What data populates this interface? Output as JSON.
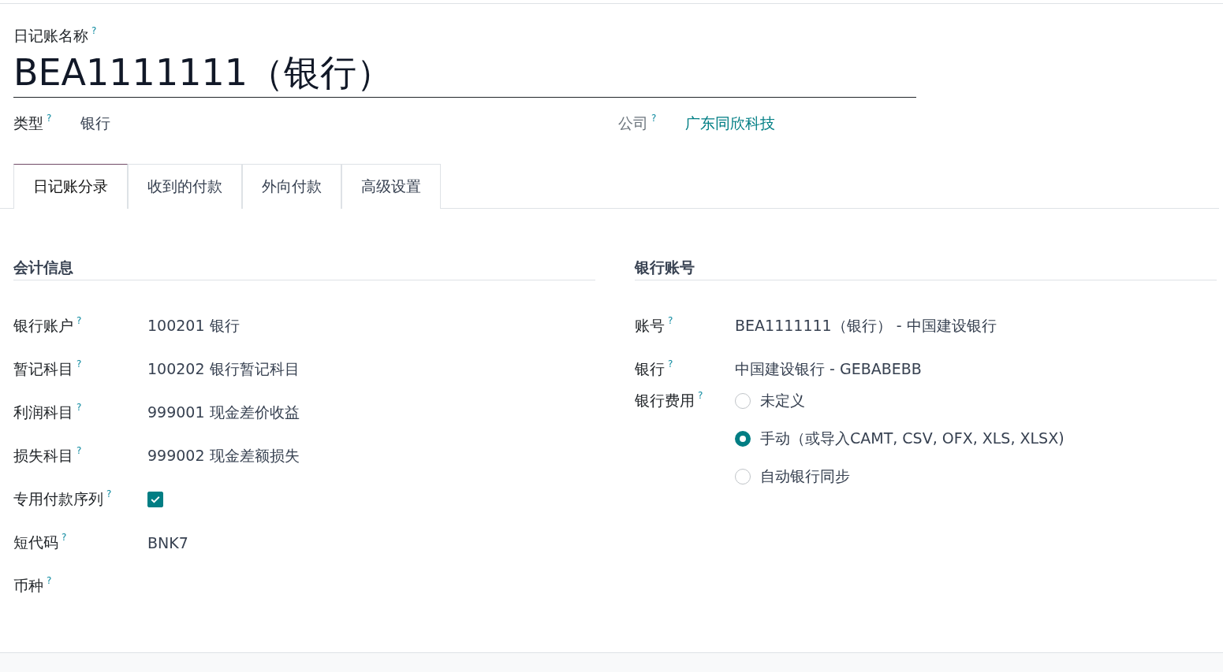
{
  "journal_name": {
    "label": "日记账名称",
    "help": "?",
    "value": "BEA1111111（银行）"
  },
  "type_field": {
    "label": "类型",
    "help": "?",
    "value": "银行"
  },
  "company_field": {
    "label": "公司",
    "help": "?",
    "value": "广东同欣科技"
  },
  "tabs": [
    {
      "label": "日记账分录",
      "selected": true
    },
    {
      "label": "收到的付款",
      "selected": false
    },
    {
      "label": "外向付款",
      "selected": false
    },
    {
      "label": "高级设置",
      "selected": false
    }
  ],
  "accounting": {
    "title": "会计信息",
    "fields": [
      {
        "kind": "text",
        "label": "银行账户",
        "help": "?",
        "value": "100201 银行"
      },
      {
        "kind": "text",
        "label": "暂记科目",
        "help": "?",
        "value": "100202 银行暂记科目"
      },
      {
        "kind": "text",
        "label": "利润科目",
        "help": "?",
        "value": "999001 现金差价收益"
      },
      {
        "kind": "text",
        "label": "损失科目",
        "help": "?",
        "value": "999002 现金差额损失"
      },
      {
        "kind": "checkbox",
        "label": "专用付款序列",
        "help": "?",
        "checked": true
      },
      {
        "kind": "text",
        "label": "短代码",
        "help": "?",
        "value": "BNK7"
      },
      {
        "kind": "text",
        "label": "币种",
        "help": "?"
      }
    ]
  },
  "bank_account": {
    "title": "银行账号",
    "fields": [
      {
        "label": "账号",
        "help": "?",
        "value": "BEA1111111（银行） - 中国建设银行"
      },
      {
        "label": "银行",
        "help": "?",
        "value": "中国建设银行 - GEBABEBB"
      }
    ],
    "fees": {
      "label": "银行费用",
      "help": "?",
      "options": [
        {
          "label": "未定义",
          "selected": false
        },
        {
          "label": "手动（或导入CAMT, CSV, OFX, XLS, XLSX)",
          "selected": true
        },
        {
          "label": "自动银行同步",
          "selected": false
        }
      ]
    }
  }
}
